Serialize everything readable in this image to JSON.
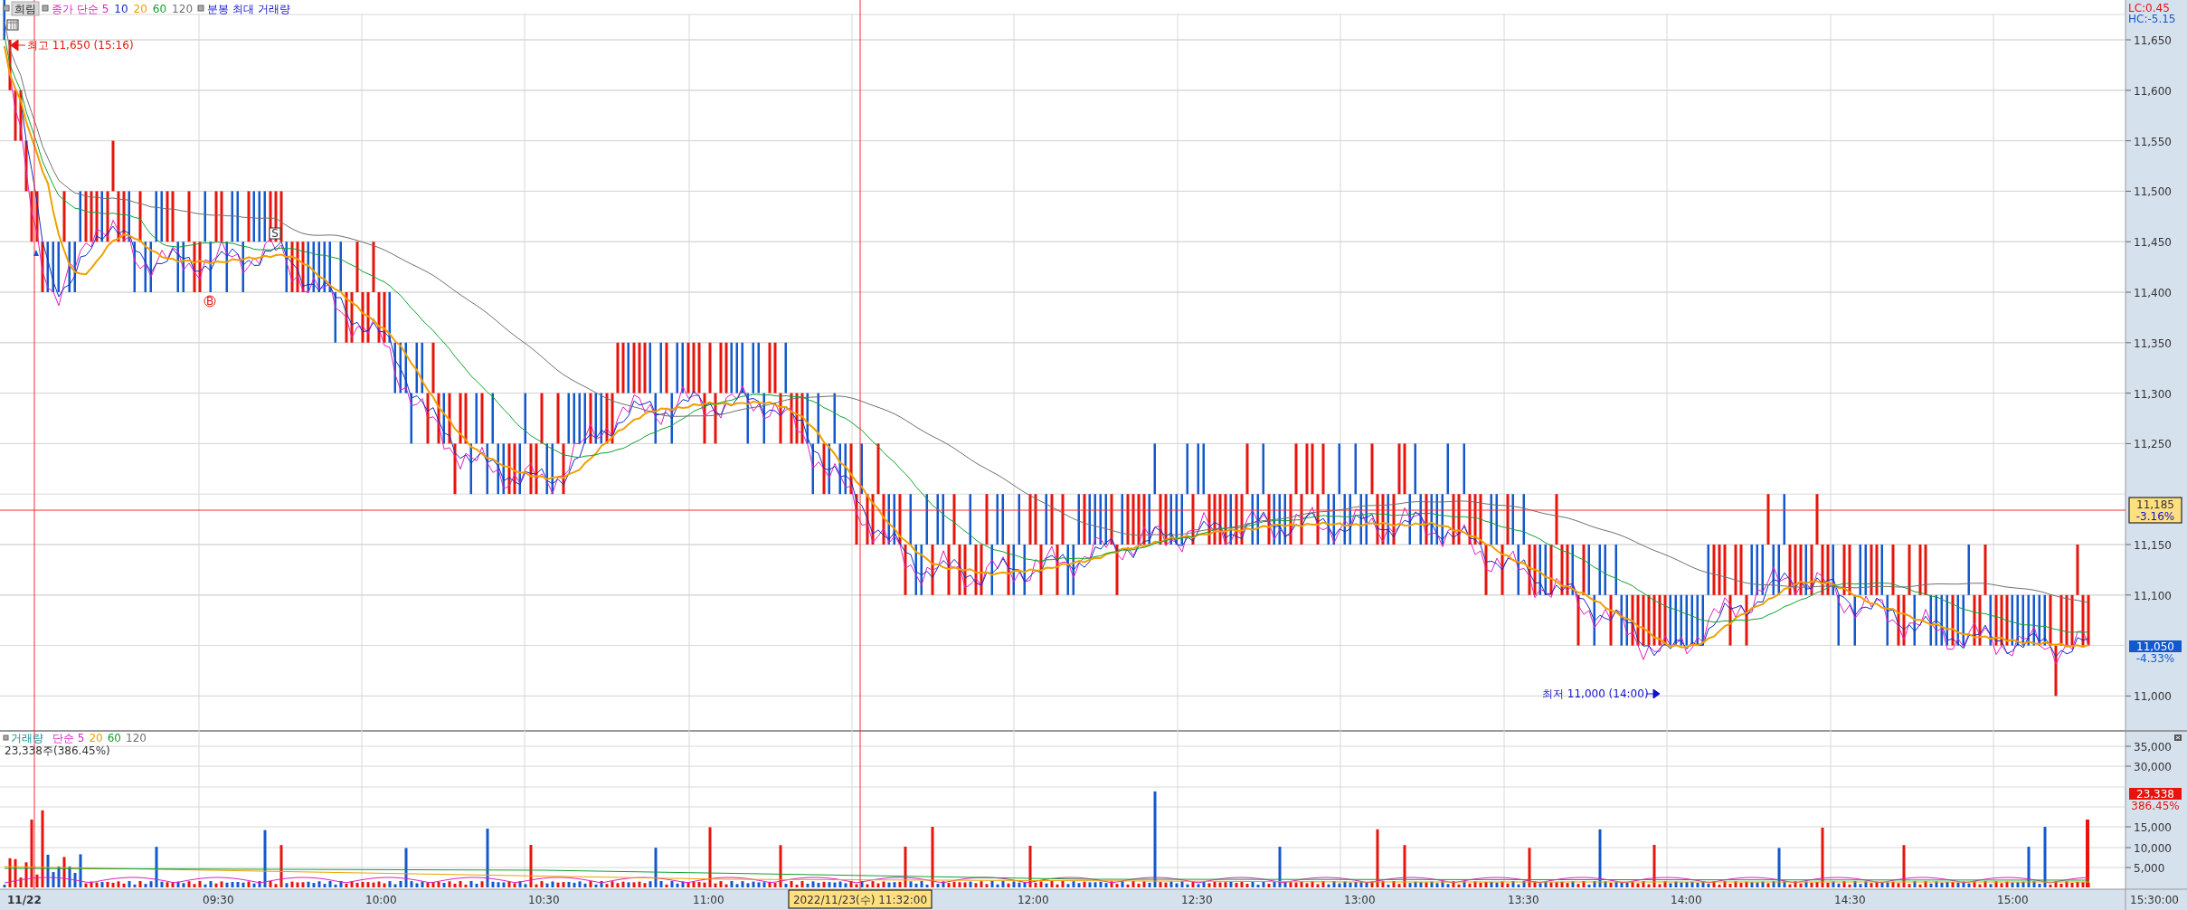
{
  "toolbar": {
    "stock_button": "희림"
  },
  "price_legend": [
    {
      "text": "종가 단순 5",
      "color": "#e020c0"
    },
    {
      "text": "10",
      "color": "#1030c0"
    },
    {
      "text": "20",
      "color": "#f0a000"
    },
    {
      "text": "60",
      "color": "#10a030"
    },
    {
      "text": "120",
      "color": "#707070"
    }
  ],
  "max_volume_label": "분봉 최대 거래량",
  "high_marker": "최고 11,650 (15:16)",
  "low_marker": "최저 11,000 (14:00)",
  "signals": [
    {
      "kind": "buy",
      "label": "B"
    },
    {
      "kind": "sell",
      "label": "S"
    }
  ],
  "price_axis": {
    "lc": "LC:0.45",
    "hc": "HC:-5.15",
    "ticks": [
      "11,650",
      "11,600",
      "11,550",
      "11,500",
      "11,450",
      "11,400",
      "11,350",
      "11,300",
      "11,250",
      "11,150",
      "11,100",
      "11,000"
    ]
  },
  "crosshair_badge": {
    "price": "11,185",
    "change": "-3.16%"
  },
  "last_badge": {
    "price": "11,050",
    "change": "-4.33%"
  },
  "volume_legend": [
    {
      "text": "거래량",
      "color": "#109090"
    },
    {
      "text": "단순 5",
      "color": "#e020c0"
    },
    {
      "text": "20",
      "color": "#f0a000"
    },
    {
      "text": "60",
      "color": "#10a030"
    },
    {
      "text": "120",
      "color": "#707070"
    }
  ],
  "volume_reading": "23,338주(386.45%)",
  "volume_axis": {
    "ticks": [
      "35,000",
      "30,000",
      "15,000",
      "10,000",
      "5,000"
    ]
  },
  "volume_badge": {
    "value": "23,338",
    "change": "386.45%"
  },
  "time_axis": {
    "labels": [
      "11/22",
      "09:30",
      "10:00",
      "10:30",
      "11:00",
      "12:00",
      "12:30",
      "13:00",
      "13:30",
      "14:00",
      "14:30",
      "15:00"
    ],
    "crosshair_label": "2022/11/23(수) 11:32:00",
    "end_label": "15:30:00"
  }
}
